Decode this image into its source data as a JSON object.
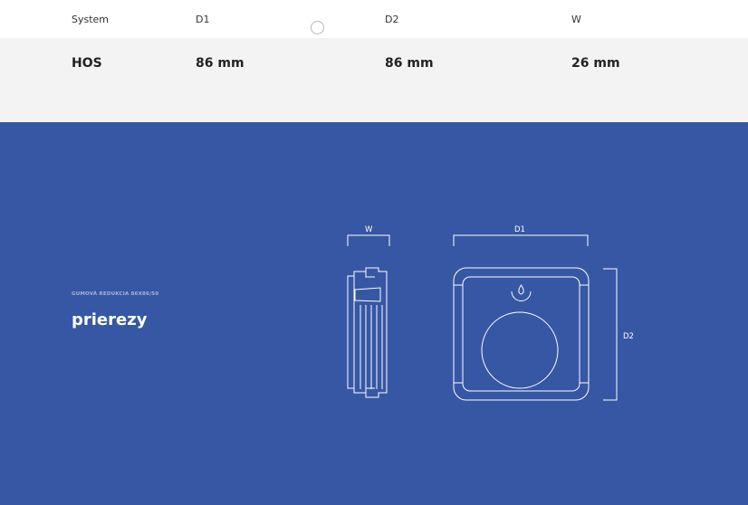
{
  "table": {
    "headers": [
      "System",
      "D1",
      "D2",
      "W"
    ],
    "row": [
      "HOS",
      "86 mm",
      "86 mm",
      "26 mm"
    ]
  },
  "section": {
    "subtitle": "GUMOVÁ REDUKCIA 86X86/50",
    "title": "prierezy"
  },
  "diagram": {
    "label_w": "W",
    "label_d1": "D1",
    "label_d2": "D2"
  },
  "colors": {
    "section_bg": "#3657a4",
    "row_bg": "#f3f3f3",
    "line": "#ffffff"
  },
  "icons": [
    "radio-icon",
    "water-drop-icon"
  ]
}
